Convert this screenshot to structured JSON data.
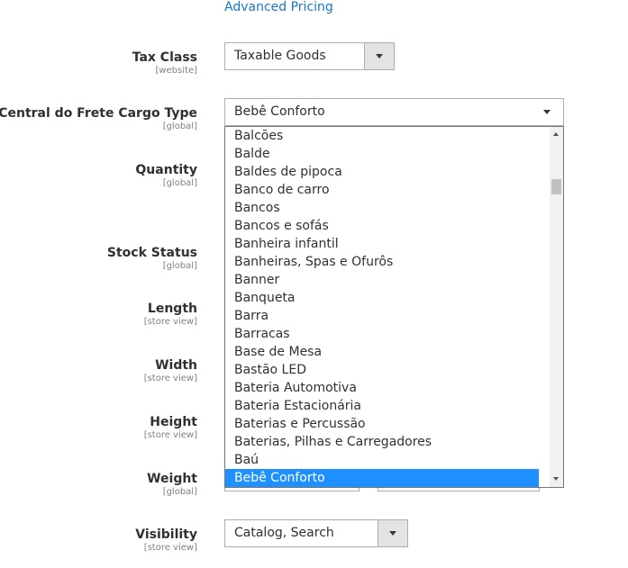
{
  "advanced_pricing_link": "Advanced Pricing",
  "fields": {
    "tax_class": {
      "label": "Tax Class",
      "scope": "[website]",
      "value": "Taxable Goods"
    },
    "cargo_type": {
      "label": "Central do Frete Cargo Type",
      "scope": "[global]",
      "value": "Bebê Conforto"
    },
    "quantity": {
      "label": "Quantity",
      "scope": "[global]"
    },
    "stock_status": {
      "label": "Stock Status",
      "scope": "[global]"
    },
    "length": {
      "label": "Length",
      "scope": "[store view]"
    },
    "width": {
      "label": "Width",
      "scope": "[store view]"
    },
    "height": {
      "label": "Height",
      "scope": "[store view]"
    },
    "weight": {
      "label": "Weight",
      "scope": "[global]"
    },
    "visibility": {
      "label": "Visibility",
      "scope": "[store view]",
      "value": "Catalog, Search"
    }
  },
  "cargo_dropdown": {
    "options": [
      "Balcões",
      "Balde",
      "Baldes de pipoca",
      "Banco de carro",
      "Bancos",
      "Bancos e sofás",
      "Banheira infantil",
      "Banheiras, Spas e Ofurôs",
      "Banner",
      "Banqueta",
      "Barra",
      "Barracas",
      "Base de Mesa",
      "Bastão LED",
      "Bateria Automotiva",
      "Bateria Estacionária",
      "Baterias e Percussão",
      "Baterias, Pilhas e Carregadores",
      "Baú",
      "Bebê Conforto"
    ],
    "selected": "Bebê Conforto"
  },
  "icons": {
    "select_arrow": "chevron-down-icon",
    "scroll_up": "scroll-up-arrow-icon",
    "scroll_down": "scroll-down-arrow-icon"
  },
  "colors": {
    "link": "#1979c3",
    "selected_option": "#1e90ff",
    "border": "#adadad",
    "arrow_bg": "#e3e3e3"
  }
}
